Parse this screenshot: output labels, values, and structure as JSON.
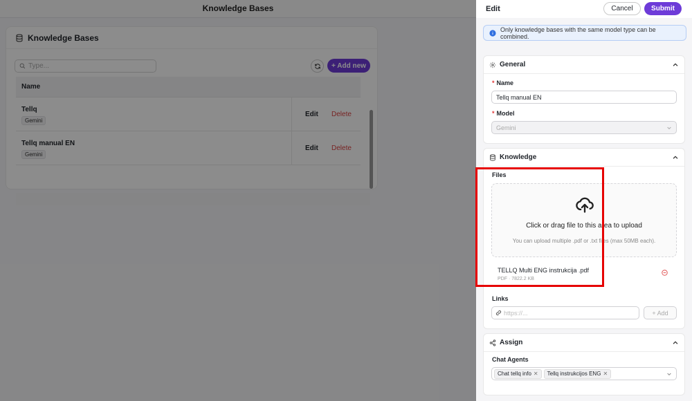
{
  "background": {
    "header_title": "Knowledge Bases",
    "card_title": "Knowledge Bases",
    "search_placeholder": "Type...",
    "add_new_label": "+ Add new",
    "table": {
      "column_name": "Name",
      "rows": [
        {
          "name": "Tellq",
          "tag": "Gemini",
          "edit": "Edit",
          "delete": "Delete"
        },
        {
          "name": "Tellq manual EN",
          "tag": "Gemini",
          "edit": "Edit",
          "delete": "Delete"
        }
      ]
    }
  },
  "drawer": {
    "title": "Edit",
    "cancel_label": "Cancel",
    "submit_label": "Submit",
    "info_text": "Only knowledge bases with the same model type can be combined.",
    "general": {
      "title": "General",
      "name_label": "Name",
      "name_value": "Tellq manual EN",
      "model_label": "Model",
      "model_value": "Gemini"
    },
    "knowledge": {
      "title": "Knowledge",
      "files_label": "Files",
      "drop_title": "Click or drag file to this area to upload",
      "drop_hint": "You can upload multiple .pdf or .txt files (max 50MB each).",
      "file_name": "TELLQ Multi ENG instrukcija .pdf",
      "file_meta": "PDF · 7822.2 KB",
      "links_label": "Links",
      "links_placeholder": "https://...",
      "add_label": "+ Add"
    },
    "assign": {
      "title": "Assign",
      "chat_agents_label": "Chat Agents",
      "agents": [
        "Chat tellq info",
        "Tellq instrukcijos ENG"
      ]
    }
  },
  "colors": {
    "accent": "#6d3bd8",
    "danger": "#d94040",
    "highlight": "#e60000"
  }
}
